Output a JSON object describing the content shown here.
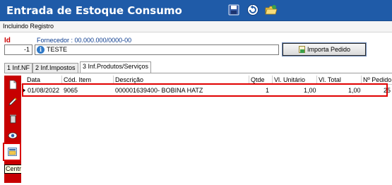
{
  "window": {
    "title": "Entrada de Estoque Consumo"
  },
  "toolbar": {
    "save_icon": "save-icon",
    "undo_icon": "undo-icon",
    "open_icon": "open-folder-icon"
  },
  "status": {
    "text": "Incluindo Registro"
  },
  "form": {
    "id_label": "Id",
    "id_value": "-1",
    "fornecedor_label": "Fornecedor : 00.000.000/0000-00",
    "fornecedor_value": "TESTE",
    "import_button": "Importa Pedido"
  },
  "tabs": [
    {
      "label": "1 Inf.NF"
    },
    {
      "label": "2 Inf.Impostos"
    },
    {
      "label": "3 Inf.Produtos/Serviços"
    }
  ],
  "grid": {
    "columns": [
      "Data",
      "Cód. Item",
      "Descrição",
      "Qtde",
      "Vl. Unitário",
      "Vl. Total",
      "Nº Pedido"
    ],
    "rows": [
      {
        "data": "01/08/2022",
        "cod": "9065",
        "descricao": "000001639400- BOBINA HATZ",
        "qtde": "1",
        "vl_unit": "1,00",
        "vl_total": "1,00",
        "pedido": "25"
      }
    ]
  },
  "side_actions": {
    "tooltip": "Centro de Custos"
  },
  "colors": {
    "title_bar": "#1f5ba8",
    "side_bar": "#c70000",
    "highlight": "#e00000",
    "tooltip_bg": "#ffffe1"
  }
}
